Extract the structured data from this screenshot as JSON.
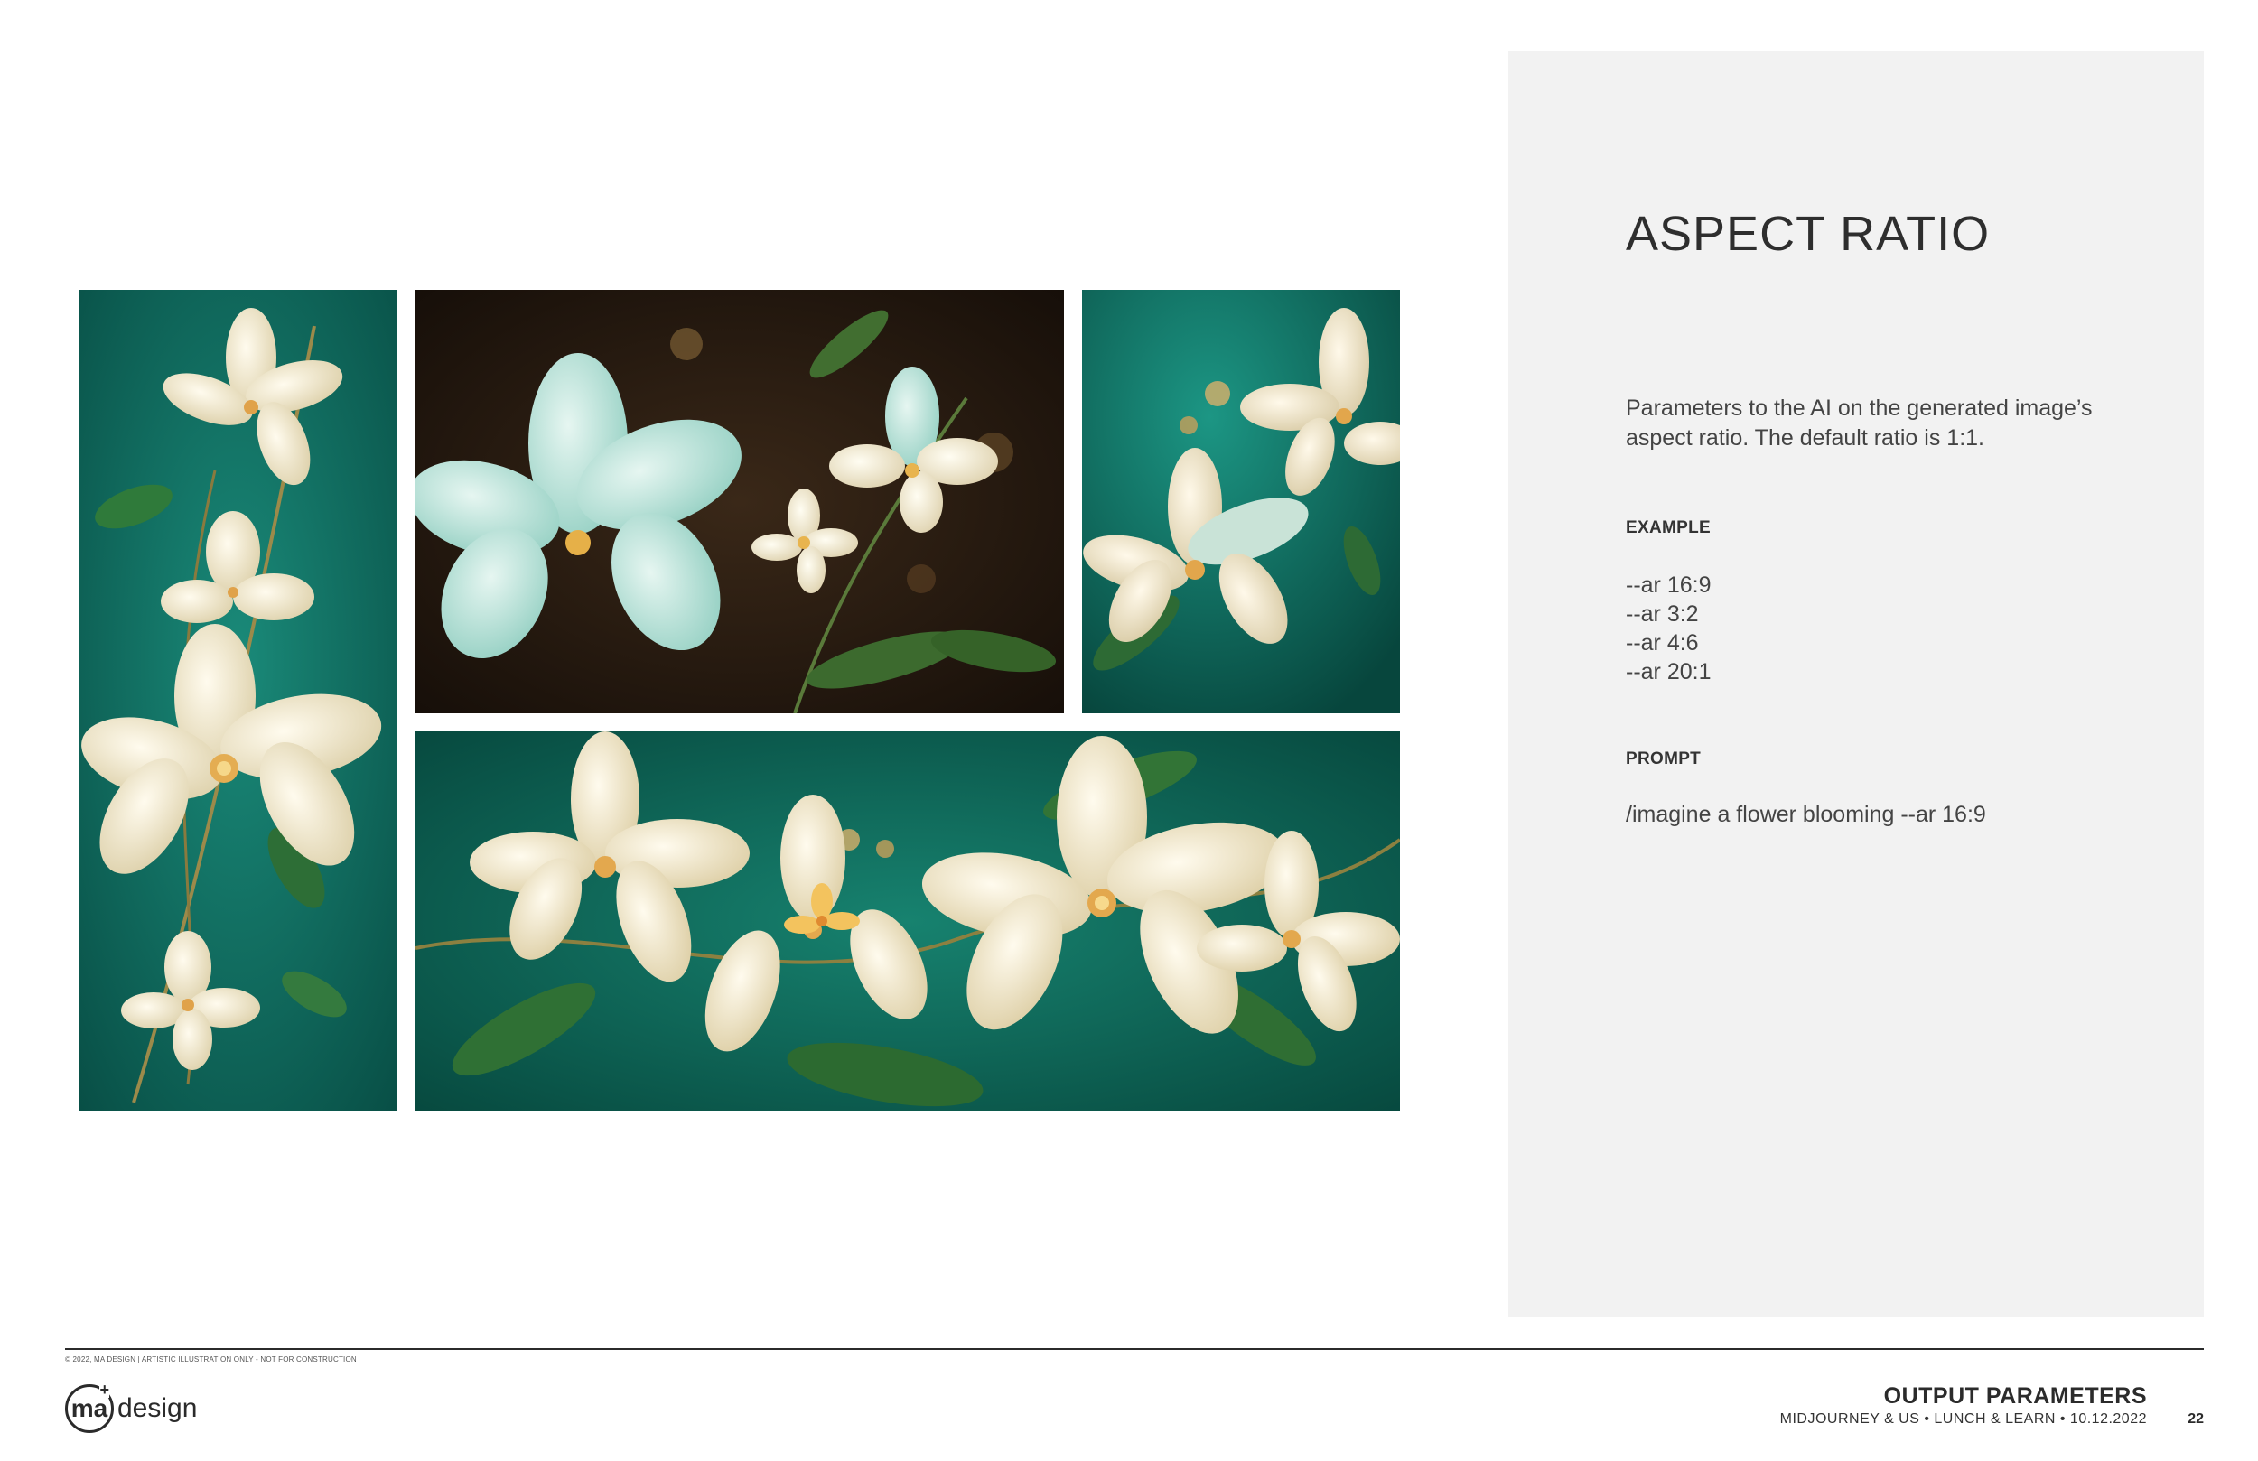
{
  "slide": {
    "title": "ASPECT RATIO",
    "description": "Parameters to the AI on the generated image’s aspect ratio. The default ratio is 1:1.",
    "example_label": "EXAMPLE",
    "examples": [
      "--ar 16:9",
      "--ar 3:2",
      "--ar 4:6",
      "--ar 20:1"
    ],
    "prompt_label": "PROMPT",
    "prompt": "/imagine a flower blooming --ar 16:9"
  },
  "images": [
    {
      "name": "flower-portrait-image",
      "subject": "cream flowers on teal background (tall)"
    },
    {
      "name": "flower-dark-image",
      "subject": "pale aqua flowers on dark background"
    },
    {
      "name": "flower-square-image",
      "subject": "cream flowers on teal background (square)"
    },
    {
      "name": "flower-wide-image",
      "subject": "cream flowers on teal background (wide)"
    }
  ],
  "colors": {
    "teal": "#0f6b5e",
    "dark_bg": "#1e140e",
    "petal_cream": "#f3ead2",
    "petal_aqua": "#bfe3dc",
    "panel": "#f2f2f2"
  },
  "footer": {
    "legal": "© 2022, MA DESIGN  |  ARTISTIC ILLUSTRATION ONLY - NOT FOR CONSTRUCTION",
    "logo_mark": "ma",
    "logo_plus": "+",
    "logo_text": "design",
    "section_title": "OUTPUT PARAMETERS",
    "subtitle": "MIDJOURNEY & US  •  LUNCH & LEARN  •  10.12.2022",
    "page": "22"
  }
}
